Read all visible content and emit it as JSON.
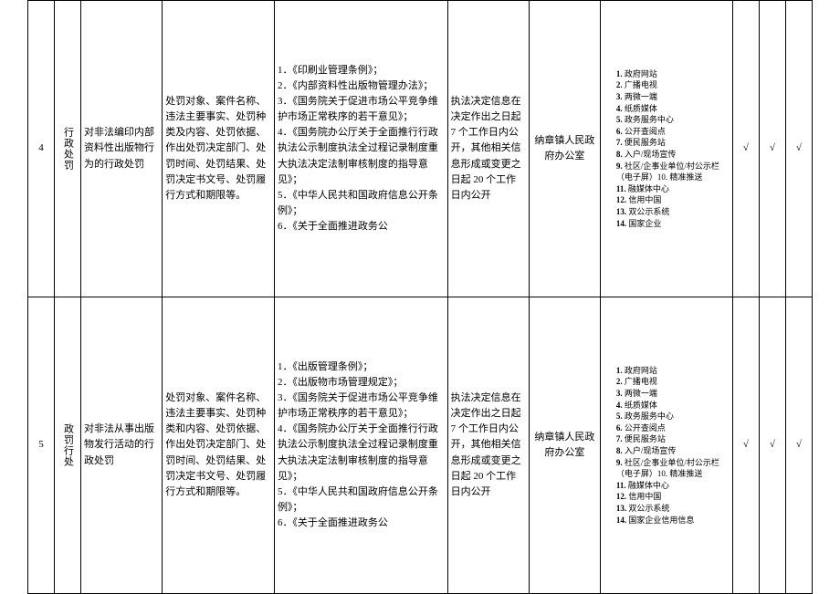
{
  "rows": [
    {
      "index": "4",
      "type": "行政处罚",
      "item": "对非法编印内部资料性出版物行为的行政处罚",
      "desc": "处罚对象、案件名称、违法主要事实、处罚种类及内容、处罚依据、作出处罚决定部门、处罚时间、处罚结果、处罚决定书文号、处罚履行方式和期限等。",
      "basis": "1．《印刷业管理条例》；\n2．《内部资料性出版物管理办法》；\n3．《国务院关于促进市场公平竞争维护市场正常秩序的若干意见》；\n4．《国务院办公厅关于全面推行行政执法公示制度执法全过程记录制度重大执法决定法制审核制度的指导意见》；\n5．《中华人民共和国政府信息公开条例》；\n6．《关于全面推进政务公",
      "time": "执法决定信息在决定作出之日起 7 个工作日内公开，其他相关信息形成或变更之日起 20 个工作日内公开",
      "org": "纳章镇人民政府办公室",
      "channels": [
        "政府网站",
        "广播电视",
        "两微一端",
        "纸质媒体",
        "政务服务中心",
        "公开查阅点",
        "便民服务站",
        "入户/现场宣传",
        "社区/企事业单位/村公示栏（电子屏）10. 精准推送",
        "",
        "融媒体中心",
        "信用中国",
        "双公示系统",
        "国家企业"
      ]
    },
    {
      "index": "5",
      "type": "政罚行处",
      "item": "对非法从事出版物发行活动的行政处罚",
      "desc": "处罚对象、案件名称、违法主要事实、处罚种类和内容、处罚依据、作出处罚决定部门、处罚时间、处罚结果、处罚决定书文号、处罚履行方式和期限等。",
      "basis": "1．《出版管理条例》；\n2．《出版物市场管理规定》；\n3．《国务院关于促进市场公平竞争维护市场正常秩序的若干意见》；\n4．《国务院办公厅关于全面推行行政执法公示制度执法全过程记录制度重大执法决定法制审核制度的指导意见》；\n5．《中华人民共和国政府信息公开条例》；\n6．《关于全面推进政务公",
      "time": "执法决定信息在决定作出之日起 7 个工作日内公开，其他相关信息形成或变更之日起 20 个工作日内公开",
      "org": "纳章镇人民政府办公室",
      "channels": [
        "政府网站",
        "广播电视",
        "两微一端",
        "纸质媒体",
        "政务服务中心",
        "公开查阅点",
        "便民服务站",
        "入户/现场宣传",
        "社区/企事业单位/村公示栏（电子屏）10. 精准推送",
        "",
        "融媒体中心",
        "信用中国",
        "双公示系统",
        "国家企业信用信息"
      ]
    }
  ],
  "checkmark": "√"
}
